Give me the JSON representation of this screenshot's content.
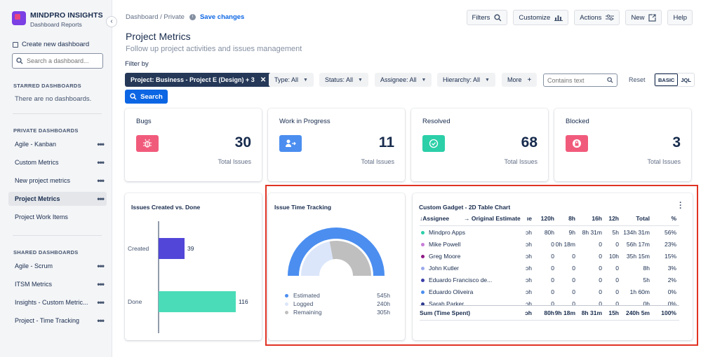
{
  "brand": {
    "title": "MINDPRO INSIGHTS",
    "subtitle": "Dashboard Reports"
  },
  "sidebar": {
    "create_label": "Create new dashboard",
    "search_placeholder": "Search a dashboard...",
    "starred_header": "STARRED DASHBOARDS",
    "starred_empty": "There are no dashboards.",
    "private_header": "PRIVATE DASHBOARDS",
    "private_items": [
      {
        "label": "Agile - Kanban"
      },
      {
        "label": "Custom Metrics"
      },
      {
        "label": "New project metrics"
      },
      {
        "label": "Project Metrics"
      },
      {
        "label": "Project Work Items"
      }
    ],
    "shared_header": "SHARED DASHBOARDS",
    "shared_items": [
      {
        "label": "Agile - Scrum"
      },
      {
        "label": "ITSM Metrics"
      },
      {
        "label": "Insights - Custom Metric..."
      },
      {
        "label": "Project - Time Tracking"
      }
    ]
  },
  "header": {
    "breadcrumb": "Dashboard / Private",
    "save_label": "Save changes",
    "buttons": {
      "filters": "Filters",
      "customize": "Customize",
      "actions": "Actions",
      "new": "New",
      "help": "Help"
    }
  },
  "page": {
    "title": "Project Metrics",
    "subtitle": "Follow up project activities and issues management"
  },
  "filters": {
    "filter_by": "Filter by",
    "project_chip": "Project: Business - Project E (Design) + 3",
    "type": "Type: All",
    "status": "Status: All",
    "assignee": "Assignee: All",
    "hierarchy": "Hierarchy: All",
    "more": "More",
    "contains_placeholder": "Contains text",
    "reset": "Reset",
    "mode_basic": "BASIC",
    "mode_jql": "JQL",
    "search_label": "Search"
  },
  "stats": [
    {
      "label": "Bugs",
      "value": "30",
      "total": "Total Issues",
      "color": "#f15b7b"
    },
    {
      "label": "Work in Progress",
      "value": "11",
      "total": "Total Issues",
      "color": "#4b8ef0"
    },
    {
      "label": "Resolved",
      "value": "68",
      "total": "Total Issues",
      "color": "#2bcfa8"
    },
    {
      "label": "Blocked",
      "value": "3",
      "total": "Total Issues",
      "color": "#f15b7b"
    }
  ],
  "created_done": {
    "title": "Issues Created vs. Done"
  },
  "time_tracking": {
    "title": "Issue Time Tracking",
    "legend": [
      {
        "label": "Estimated",
        "value": "545h",
        "color": "#4b8ef0"
      },
      {
        "label": "Logged",
        "value": "240h",
        "color": "#dbe6fb"
      },
      {
        "label": "Remaining",
        "value": "305h",
        "color": "#bfbfbf"
      }
    ]
  },
  "table_gadget": {
    "title": "Custom Gadget - 2D Table Chart",
    "headers": {
      "assignee": "↓Assignee",
      "orig": "→ Original Estimate",
      "c0": "ıe",
      "c1": "120h",
      "c2": "8h",
      "c3": "16h",
      "c4": "12h",
      "total": "Total",
      "pct": "%"
    },
    "rows": [
      {
        "name": "Mindpro Apps",
        "color": "#2bcfa8",
        "c0": "ɔh",
        "c1": "80h",
        "c2": "9h",
        "c3": "8h 31m",
        "c4": "5h",
        "total": "134h 31m",
        "pct": "56%"
      },
      {
        "name": "Mike Powell",
        "color": "#c77dd8",
        "c0": "ɔh",
        "c1": "0",
        "c2": "0h 18m",
        "c3": "0",
        "c4": "0",
        "total": "56h 17m",
        "pct": "23%"
      },
      {
        "name": "Greg Moore",
        "color": "#8e1b86",
        "c0": "ɔh",
        "c1": "0",
        "c2": "0",
        "c3": "0",
        "c4": "10h",
        "total": "35h 15m",
        "pct": "15%"
      },
      {
        "name": "John Kutler",
        "color": "#9aa9ee",
        "c0": "ɔh",
        "c1": "0",
        "c2": "0",
        "c3": "0",
        "c4": "0",
        "total": "8h",
        "pct": "3%"
      },
      {
        "name": "Eduardo Francisco de...",
        "color": "#3b3fa8",
        "c0": "ɔh",
        "c1": "0",
        "c2": "0",
        "c3": "0",
        "c4": "0",
        "total": "5h",
        "pct": "2%"
      },
      {
        "name": "Eduardo Oliveira",
        "color": "#4b8ef0",
        "c0": "ɔh",
        "c1": "0",
        "c2": "0",
        "c3": "0",
        "c4": "0",
        "total": "1h 60m",
        "pct": "0%"
      },
      {
        "name": "Sarah Parker",
        "color": "#2d3b8f",
        "c0": "ɔh",
        "c1": "0",
        "c2": "0",
        "c3": "0",
        "c4": "0",
        "total": "0h",
        "pct": "0%"
      }
    ],
    "sum": {
      "label": "Sum (Time Spent)",
      "c0": "ɔh",
      "c1": "80h",
      "c2": "9h 18m",
      "c3": "8h 31m",
      "c4": "15h",
      "total": "240h 5m",
      "pct": "100%"
    }
  },
  "chart_data": [
    {
      "type": "bar",
      "orientation": "horizontal",
      "title": "Issues Created vs. Done",
      "categories": [
        "Created",
        "Done"
      ],
      "values": [
        39,
        116
      ],
      "colors": [
        "#5146d8",
        "#4adcb8"
      ]
    },
    {
      "type": "pie",
      "style": "half-donut",
      "title": "Issue Time Tracking",
      "categories": [
        "Estimated",
        "Logged",
        "Remaining"
      ],
      "values": [
        545,
        240,
        305
      ],
      "colors": [
        "#4b8ef0",
        "#dbe6fb",
        "#bfbfbf"
      ]
    }
  ]
}
